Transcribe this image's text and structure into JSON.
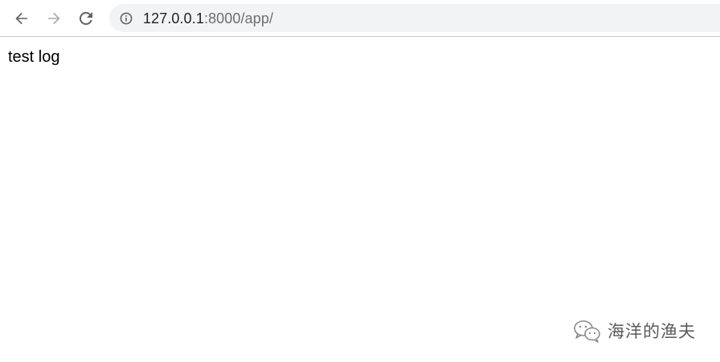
{
  "browser": {
    "url_host": "127.0.0.1",
    "url_rest": ":8000/app/",
    "icons": {
      "back": "arrow-left-icon",
      "forward": "arrow-right-icon",
      "reload": "reload-icon",
      "info": "info-icon"
    }
  },
  "page": {
    "body_text": "test log"
  },
  "watermark": {
    "text": "海洋的渔夫",
    "icon": "wechat-icon"
  },
  "colors": {
    "omnibox_bg": "#f1f3f4",
    "host_text": "#202124",
    "path_text": "#6e6e6e",
    "icon_dark": "#5f6368",
    "icon_disabled": "#a8abad"
  }
}
